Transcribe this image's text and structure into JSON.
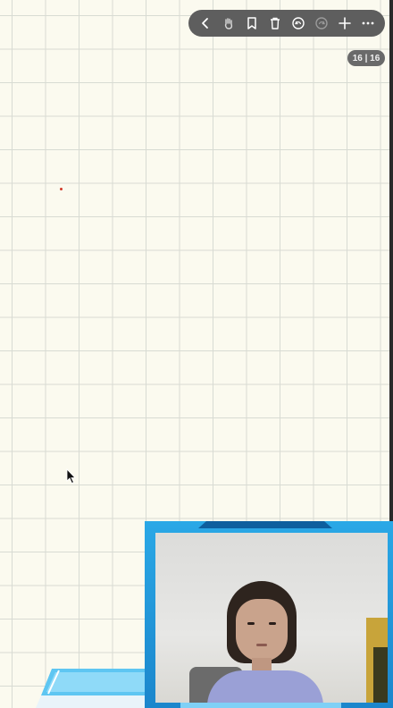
{
  "toolbar": {
    "items": [
      {
        "icon": "back-chevron-icon"
      },
      {
        "icon": "hand-tool-icon"
      },
      {
        "icon": "bookmark-icon"
      },
      {
        "icon": "trash-icon"
      },
      {
        "icon": "undo-icon"
      },
      {
        "icon": "redo-icon"
      },
      {
        "icon": "add-icon"
      },
      {
        "icon": "more-icon"
      }
    ]
  },
  "page_counter": "16 | 16",
  "colors": {
    "paper": "#fbfaef",
    "grid": "#d8dbd3",
    "toolbar": "#5e5e5e",
    "frame": "#1b86cc",
    "ink": "#d23a2a"
  }
}
